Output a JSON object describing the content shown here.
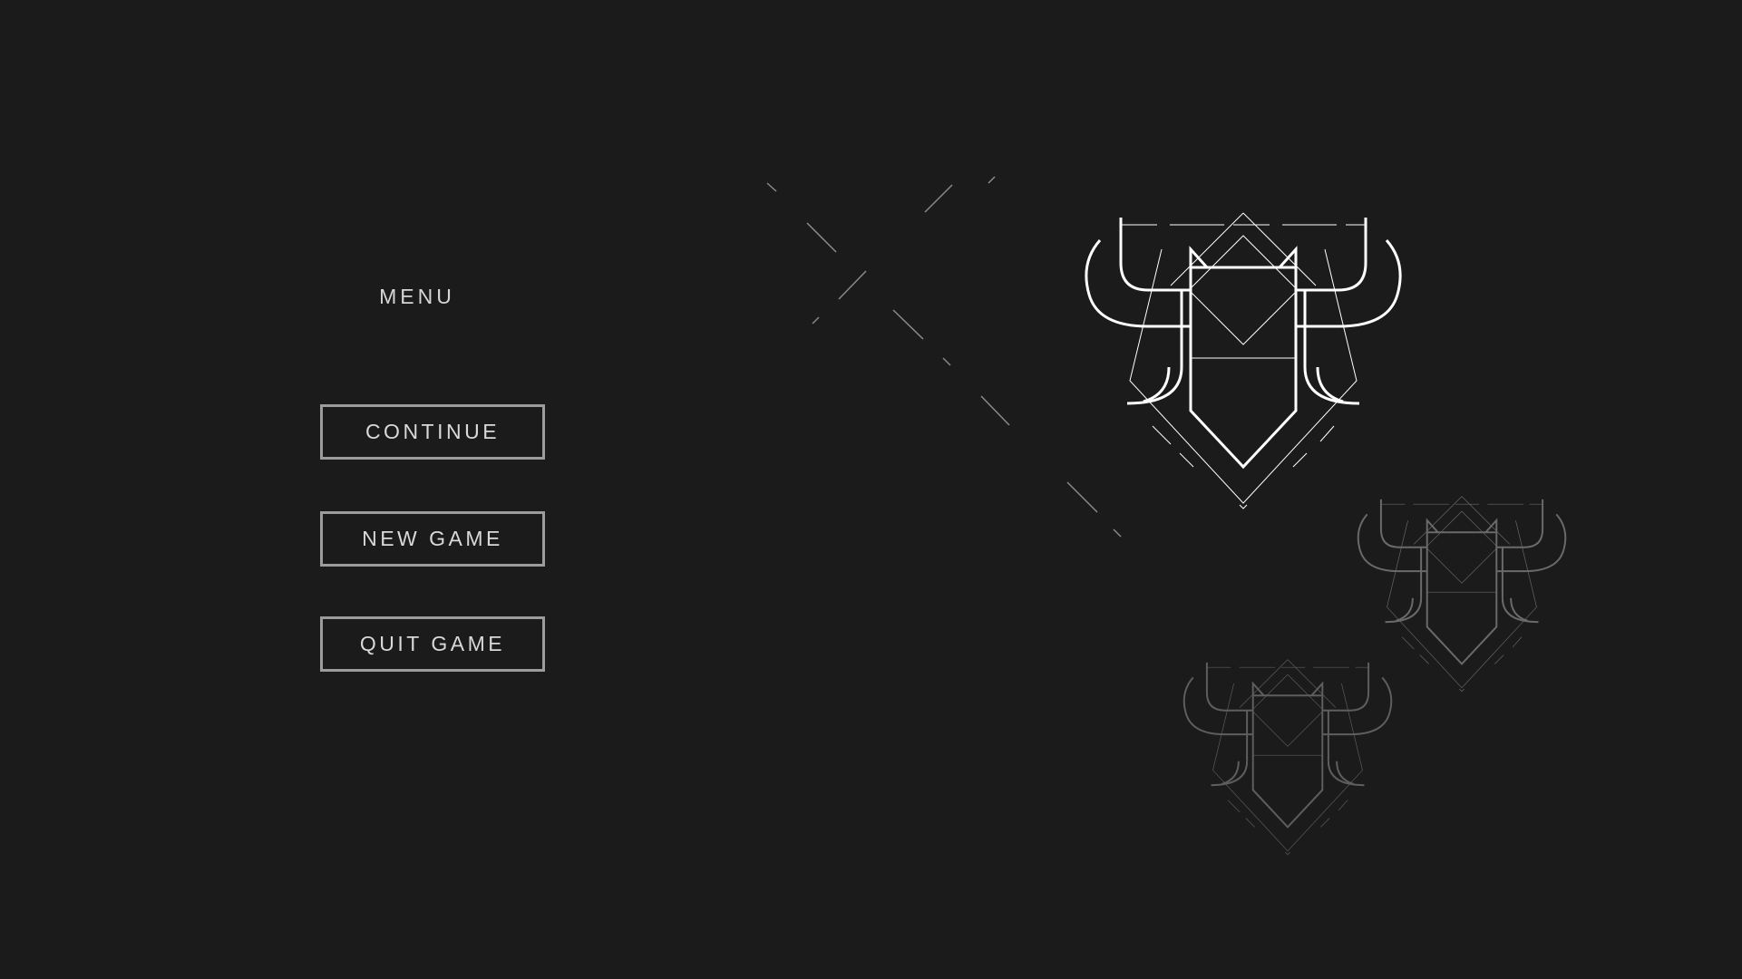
{
  "menu": {
    "title": "MENU",
    "buttons": {
      "continue": "CONTINUE",
      "new_game": "NEW GAME",
      "quit_game": "QUIT GAME"
    }
  },
  "colors": {
    "background": "#1b1b1b",
    "button_border": "#9c9c9c",
    "text": "#d9d9d9",
    "emblem_main": "#ffffff",
    "emblem_faded": "#6a6a6a"
  },
  "icons": {
    "emblem": "bull-head-emblem-icon"
  }
}
